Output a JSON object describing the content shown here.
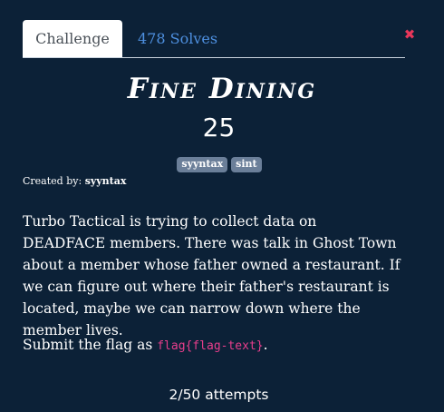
{
  "tabs": [
    {
      "label": "Challenge",
      "active": true
    },
    {
      "label": "478 Solves",
      "active": false
    }
  ],
  "close_icon": "close-icon",
  "challenge": {
    "title": "Fine Dining",
    "points": "25",
    "tags": [
      "syyntax",
      "sint"
    ],
    "created_by_label": "Created by:",
    "author": "syyntax",
    "description": "Turbo Tactical is trying to collect data on DEADFACE members. There was talk in Ghost Town about a member whose father owned a restaurant. If we can figure out where their father's restaurant is located, maybe we can narrow down where the member lives.",
    "submit_prefix": "Submit the flag as",
    "flag_format": "flag{flag-text}",
    "submit_suffix": ".",
    "attempts": "2/50 attempts"
  },
  "colors": {
    "background": "#0c2137",
    "link": "#4e90e0",
    "close": "#e8375a",
    "code": "#e83e8c",
    "tag_bg": "#6b7f99"
  }
}
